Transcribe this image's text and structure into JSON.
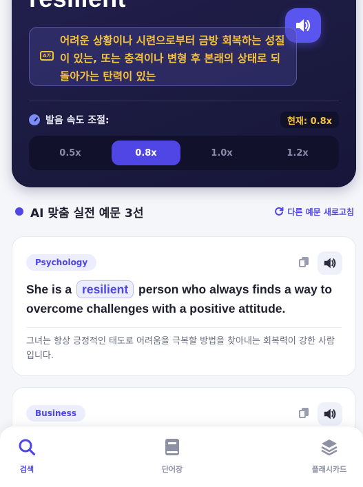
{
  "hero": {
    "word": "resilient",
    "meaning": "어려운 상황이나 시련으로부터 금방 회복하는 성질이 있는, 또는 충격이나 변형 후 본래의 상태로 되돌아가는 탄력이 있는",
    "meaning_icon_text": "A가",
    "speed_label": "발음 속도 조절:",
    "speed_current": "현재: 0.8x",
    "speed_options": [
      "0.5x",
      "0.8x",
      "1.0x",
      "1.2x"
    ],
    "speed_selected": "0.8x"
  },
  "section": {
    "title": "AI 맞춤 실전 예문 3선",
    "refresh_label": "다른 예문 새로고침"
  },
  "examples": [
    {
      "tag": "Psychology",
      "sentence_before": "She is a",
      "highlight": "resilient",
      "sentence_after": "person who always finds a way to overcome challenges with a positive attitude.",
      "translation": "그녀는 항상 긍정적인 태도로 어려움을 극복할 방법을 찾아내는 회복력이 강한 사람입니다."
    },
    {
      "tag": "Business"
    }
  ],
  "nav": {
    "search": "검색",
    "vocab": "단어장",
    "flashcard": "플래시카드"
  },
  "colors": {
    "accent": "#4f46e5",
    "hero_bg": "#1b1a3f",
    "meaning_text": "#f5c23a"
  }
}
